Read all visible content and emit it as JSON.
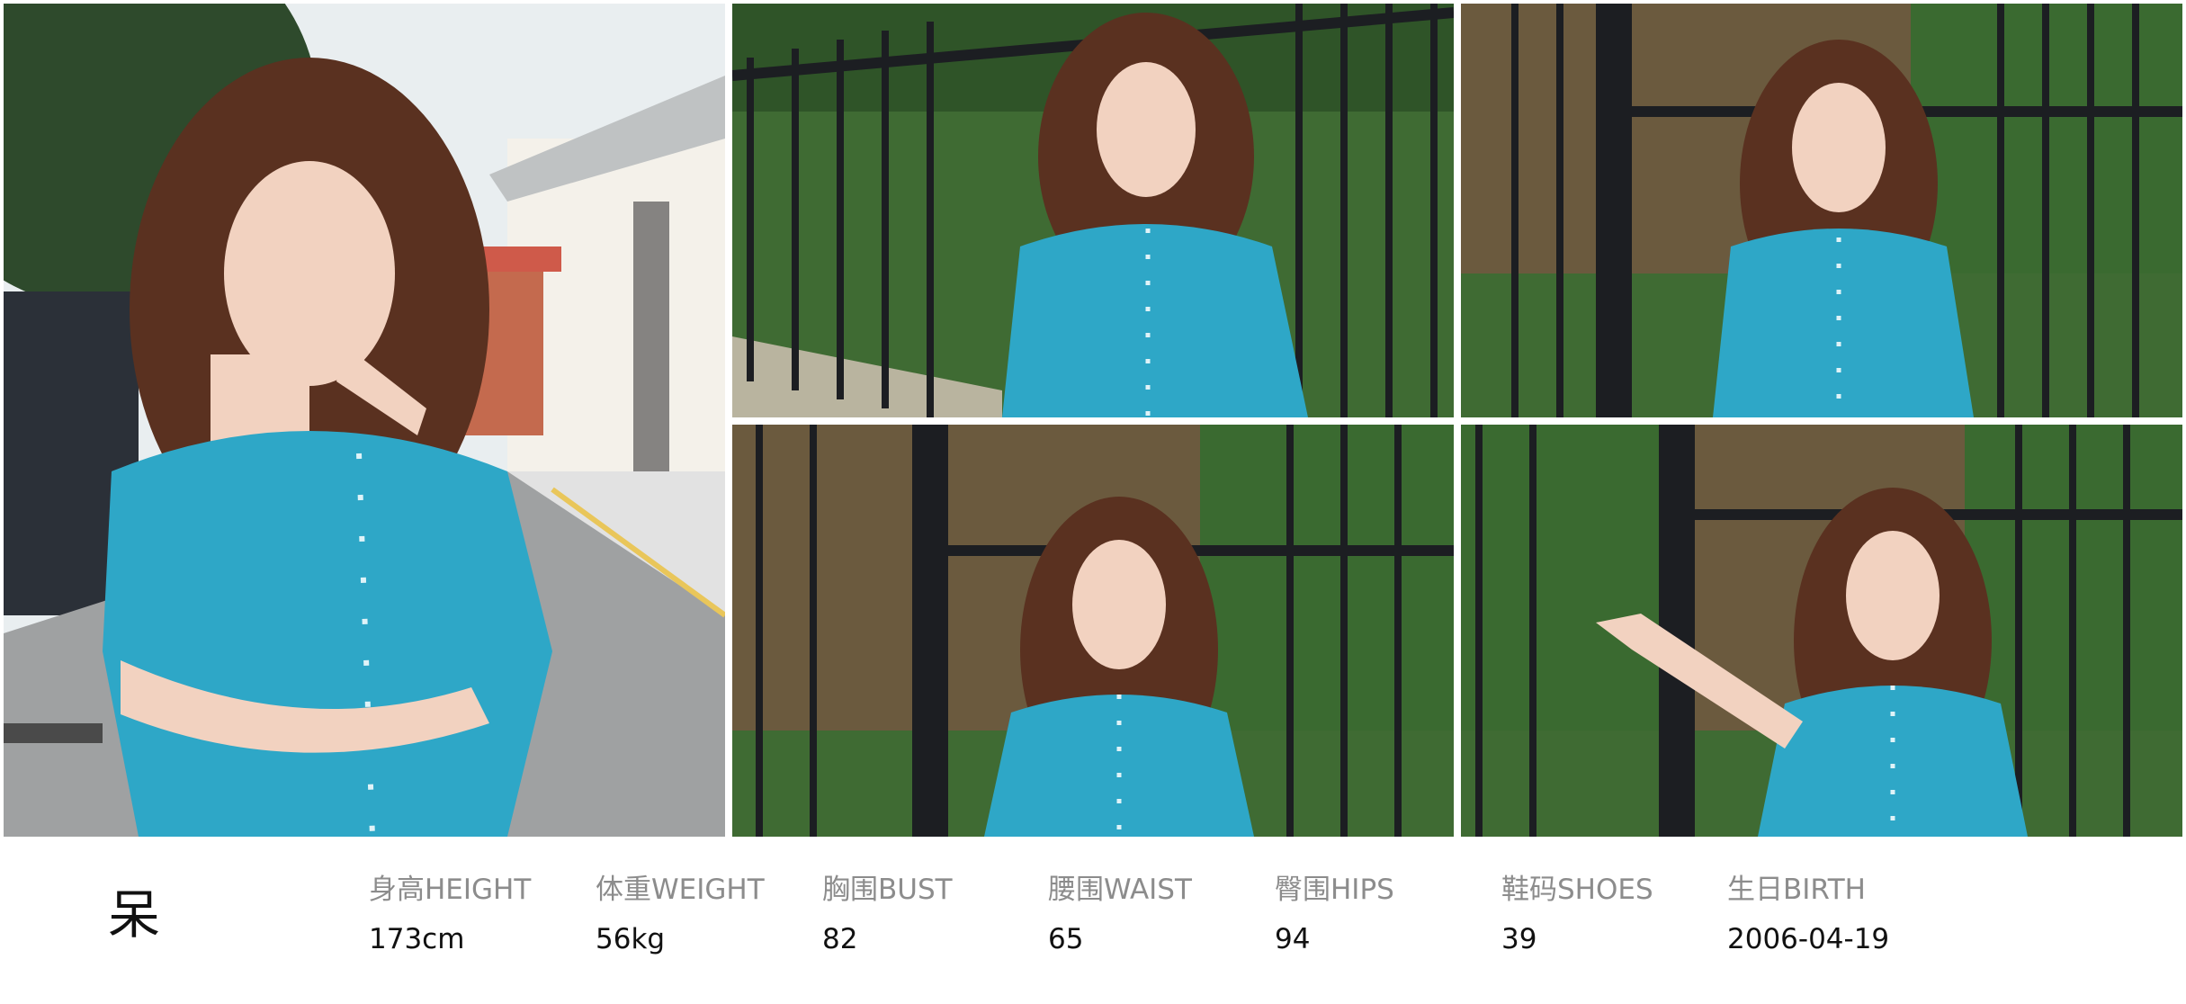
{
  "model": {
    "name": "呆"
  },
  "stats": [
    {
      "label": "身高HEIGHT",
      "value": "173cm"
    },
    {
      "label": "体重WEIGHT",
      "value": "56kg"
    },
    {
      "label": "胸围BUST",
      "value": "82"
    },
    {
      "label": "腰围WAIST",
      "value": "65"
    },
    {
      "label": "臀围HIPS",
      "value": "94"
    },
    {
      "label": "鞋码SHOES",
      "value": "39"
    },
    {
      "label": "生日BIRTH",
      "value": "2006-04-19"
    }
  ],
  "colors": {
    "shirt": "#2ea7c7",
    "hair": "#5a3120",
    "skin": "#f2d2c0",
    "fence": "#1c1e22",
    "foliage": "#3f6b33",
    "label_gray": "#8c8c8c",
    "value_black": "#111111"
  }
}
